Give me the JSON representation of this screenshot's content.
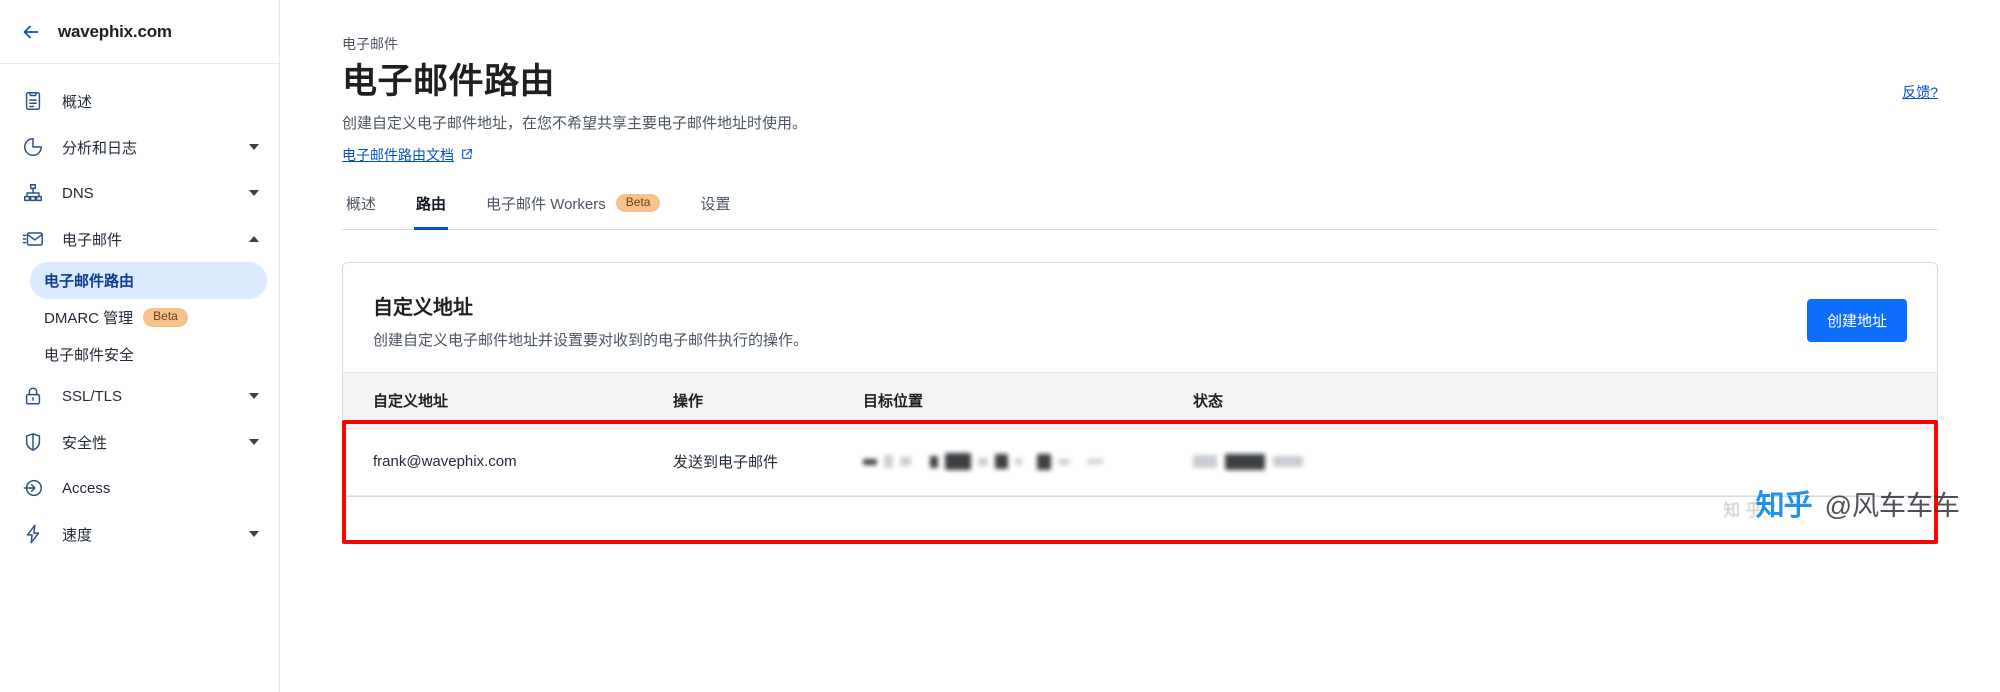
{
  "sidebar": {
    "back_icon": "arrow-left-icon",
    "domain": "wavephix.com",
    "items": [
      {
        "icon": "clipboard-icon",
        "label": "概述",
        "expandable": false
      },
      {
        "icon": "pie-chart-icon",
        "label": "分析和日志",
        "expandable": true
      },
      {
        "icon": "dns-tree-icon",
        "label": "DNS",
        "expandable": true
      },
      {
        "icon": "email-icon",
        "label": "电子邮件",
        "expandable": true,
        "expanded": true
      },
      {
        "icon": "lock-icon",
        "label": "SSL/TLS",
        "expandable": true
      },
      {
        "icon": "shield-icon",
        "label": "安全性",
        "expandable": true
      },
      {
        "icon": "access-icon",
        "label": "Access",
        "expandable": false
      },
      {
        "icon": "bolt-icon",
        "label": "速度",
        "expandable": true
      }
    ],
    "email_subitems": [
      {
        "label": "电子邮件路由",
        "active": true,
        "badge": ""
      },
      {
        "label": "DMARC 管理",
        "active": false,
        "badge": "Beta"
      },
      {
        "label": "电子邮件安全",
        "active": false,
        "badge": ""
      }
    ]
  },
  "header": {
    "breadcrumb": "电子邮件",
    "title": "电子邮件路由",
    "description": "创建自定义电子邮件地址，在您不希望共享主要电子邮件地址时使用。",
    "doc_link": "电子邮件路由文档",
    "doc_link_icon": "external-link-icon",
    "feedback_link": "反馈?"
  },
  "tabs": [
    {
      "label": "概述",
      "active": false,
      "badge": ""
    },
    {
      "label": "路由",
      "active": true,
      "badge": ""
    },
    {
      "label": "电子邮件 Workers",
      "active": false,
      "badge": "Beta"
    },
    {
      "label": "设置",
      "active": false,
      "badge": ""
    }
  ],
  "card": {
    "title": "自定义地址",
    "description": "创建自定义电子邮件地址并设置要对收到的电子邮件执行的操作。",
    "create_button": "创建地址"
  },
  "table": {
    "columns": [
      "自定义地址",
      "操作",
      "目标位置",
      "状态"
    ],
    "rows": [
      {
        "address": "frank@wavephix.com",
        "action": "发送到电子邮件",
        "destination": "",
        "destination_redacted": true,
        "status": "",
        "status_redacted": true
      }
    ]
  },
  "watermark": {
    "platform": "知乎",
    "handle": "@风车车车"
  },
  "colors": {
    "accent_blue": "#0051c3",
    "button_blue": "#0d6efd",
    "active_nav_bg": "#dbeafe",
    "beta_badge_bg": "#f6c28b",
    "annotation_red": "#ff0000",
    "table_header_bg": "#f3f4f6"
  }
}
